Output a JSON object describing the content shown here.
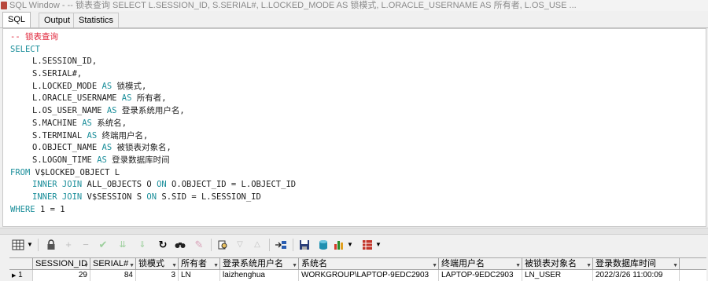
{
  "title": "SQL Window - -- 锁表查询 SELECT L.SESSION_ID, S.SERIAL#, L.LOCKED_MODE AS 锁模式, L.ORACLE_USERNAME AS 所有者, L.OS_USE ...",
  "tabs": [
    {
      "label": "SQL",
      "active": true
    },
    {
      "label": "Output",
      "active": false
    },
    {
      "label": "Statistics",
      "active": false
    }
  ],
  "sql": {
    "comment": "-- 锁表查询",
    "kw_select": "SELECT",
    "kw_as": "AS",
    "kw_from": "FROM",
    "kw_inner_join": "INNER JOIN",
    "kw_on": "ON",
    "kw_where": "WHERE",
    "col_session_id": "L.SESSION_ID,",
    "col_serial": "S.SERIAL#,",
    "col_locked_mode": "L.LOCKED_MODE",
    "alias_locked_mode": "锁模式,",
    "col_oracle_username": "L.ORACLE_USERNAME",
    "alias_oracle_username": "所有者,",
    "col_os_user_name": "L.OS_USER_NAME",
    "alias_os_user_name": "登录系统用户名,",
    "col_machine": "S.MACHINE",
    "alias_machine": "系统名,",
    "col_terminal": "S.TERMINAL",
    "alias_terminal": "终端用户名,",
    "col_object_name": "O.OBJECT_NAME",
    "alias_object_name": "被锁表对象名,",
    "col_logon_time": "S.LOGON_TIME",
    "alias_logon_time": "登录数据库时间",
    "from_table": "V$LOCKED_OBJECT L",
    "join1_table": "ALL_OBJECTS O",
    "join1_cond": "O.OBJECT_ID = L.OBJECT_ID",
    "join2_table": "V$SESSION S",
    "join2_cond": "S.SID = L.SESSION_ID",
    "where_cond": "1 = 1"
  },
  "toolbar": {
    "icons": [
      "grid-view-icon",
      "lock-icon",
      "add-record-icon",
      "delete-record-icon",
      "post-changes-icon",
      "next-page-icon",
      "last-page-icon",
      "refresh-icon",
      "find-icon",
      "clear-icon",
      "query-by-example-icon",
      "sort-down-icon",
      "sort-up-icon",
      "link-query-icon",
      "save-icon",
      "export-icon",
      "chart-icon",
      "print-icon"
    ]
  },
  "grid": {
    "headers": [
      "SESSION_ID",
      "SERIAL#",
      "锁模式",
      "所有者",
      "登录系统用户名",
      "系统名",
      "终端用户名",
      "被锁表对象名",
      "登录数据库时间"
    ],
    "rows": [
      {
        "row_no": "1",
        "session_id": "29",
        "serial": "84",
        "locked_mode": "3",
        "owner": "LN",
        "os_user": "laizhenghua",
        "machine": "WORKGROUP\\LAPTOP-9EDC2903",
        "terminal": "LAPTOP-9EDC2903",
        "object_name": "LN_USER",
        "logon_time": "2022/3/26 11:00:09"
      }
    ]
  }
}
